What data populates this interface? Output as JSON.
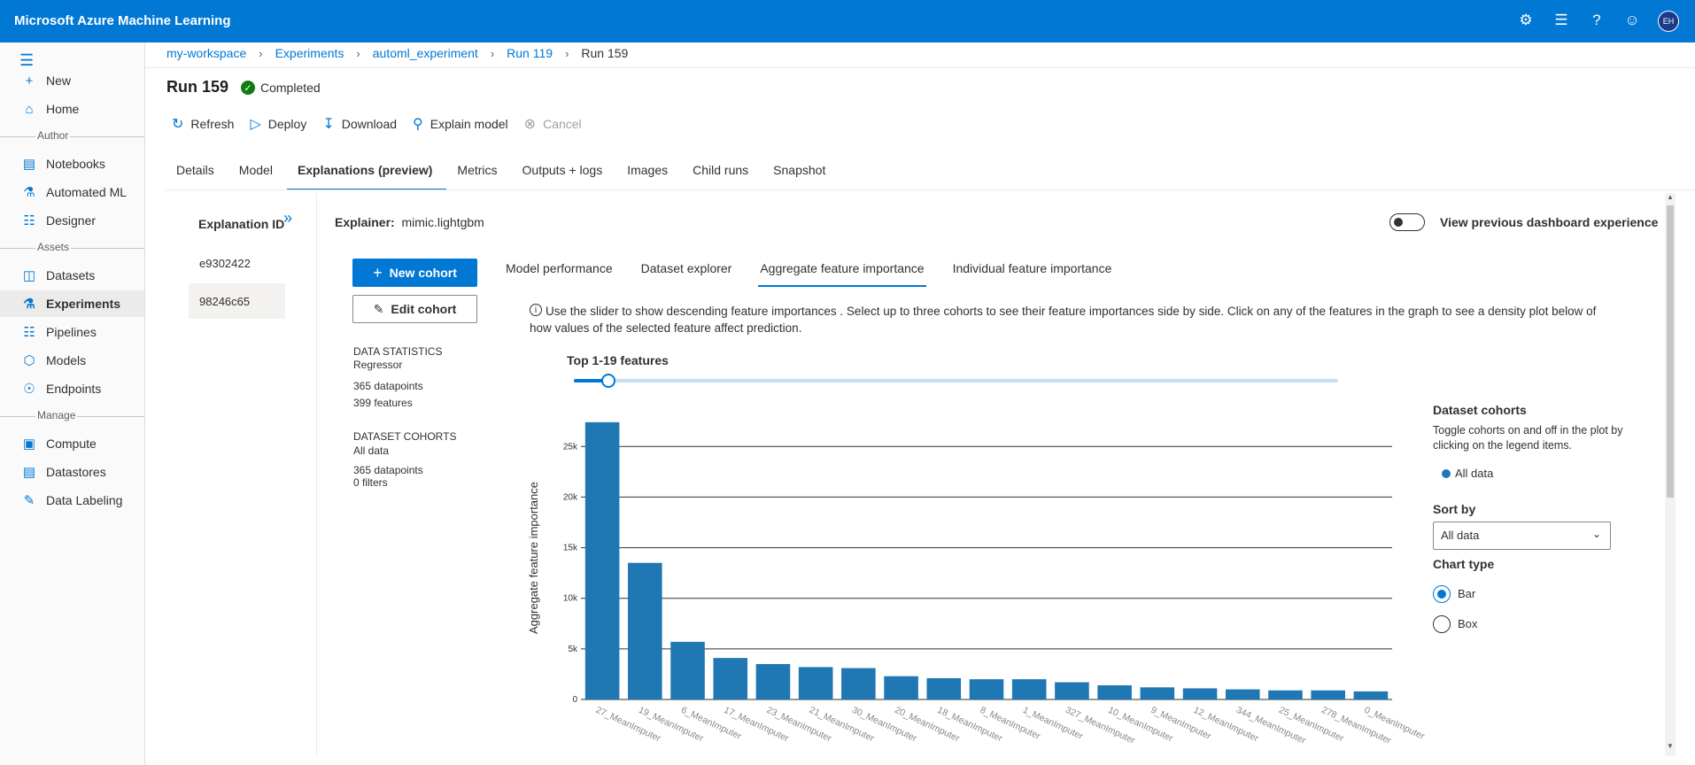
{
  "app": {
    "title": "Microsoft Azure Machine Learning",
    "user_initials": "EH"
  },
  "topbar_icons": [
    "settings-icon",
    "feedback-icon",
    "help-icon",
    "smiley-icon"
  ],
  "sidebar": {
    "items": [
      {
        "label": "New",
        "icon": "plus-icon"
      },
      {
        "label": "Home",
        "icon": "home-icon"
      },
      {
        "label": "Notebooks",
        "icon": "notebook-icon"
      },
      {
        "label": "Automated ML",
        "icon": "automl-icon"
      },
      {
        "label": "Designer",
        "icon": "designer-icon"
      },
      {
        "label": "Datasets",
        "icon": "datasets-icon"
      },
      {
        "label": "Experiments",
        "icon": "flask-icon"
      },
      {
        "label": "Pipelines",
        "icon": "pipelines-icon"
      },
      {
        "label": "Models",
        "icon": "models-icon"
      },
      {
        "label": "Endpoints",
        "icon": "endpoints-icon"
      },
      {
        "label": "Compute",
        "icon": "compute-icon"
      },
      {
        "label": "Datastores",
        "icon": "datastores-icon"
      },
      {
        "label": "Data Labeling",
        "icon": "labeling-icon"
      }
    ],
    "sections": [
      "Author",
      "Assets",
      "Manage"
    ]
  },
  "breadcrumb": [
    "my-workspace",
    "Experiments",
    "automl_experiment",
    "Run 119",
    "Run 159"
  ],
  "run": {
    "title": "Run 159",
    "status": "Completed"
  },
  "toolbar": [
    "Refresh",
    "Deploy",
    "Download",
    "Explain model",
    "Cancel"
  ],
  "tabs": [
    "Details",
    "Model",
    "Explanations (preview)",
    "Metrics",
    "Outputs + logs",
    "Images",
    "Child runs",
    "Snapshot"
  ],
  "explanations": {
    "header": "Explanation ID",
    "ids": [
      "e9302422",
      "98246c65"
    ]
  },
  "explainer": {
    "label": "Explainer:",
    "value": "mimic.lightgbm"
  },
  "toggle_label": "View previous dashboard experience",
  "buttons": {
    "new_cohort": "New cohort",
    "edit_cohort": "Edit cohort"
  },
  "stats": {
    "data_statistics": "DATA STATISTICS",
    "model_type": "Regressor",
    "datapoints": "365 datapoints",
    "features": "399 features",
    "dataset_cohorts": "DATASET COHORTS",
    "cohort_name": "All data",
    "cohort_datapoints": "365 datapoints",
    "cohort_filters": "0 filters"
  },
  "subtabs": [
    "Model performance",
    "Dataset explorer",
    "Aggregate feature importance",
    "Individual feature importance"
  ],
  "info_text": "Use the slider to show descending feature importances . Select up to three cohorts to see their feature importances side by side. Click on any of the features in the graph to see a density plot below of how values of the selected feature affect prediction.",
  "slider": {
    "label": "Top 1-19 features",
    "value_fraction": 0.05
  },
  "right_panel": {
    "cohorts_title": "Dataset cohorts",
    "cohorts_desc": "Toggle cohorts on and off in the plot by clicking on the legend items.",
    "legend_item": "All data",
    "sort_by_label": "Sort by",
    "sort_by_value": "All data",
    "chart_type_label": "Chart type",
    "chart_types": [
      "Bar",
      "Box"
    ],
    "selected_chart_type": "Bar"
  },
  "chart_data": {
    "type": "bar",
    "ylabel": "Aggregate feature importance",
    "xlabel": "",
    "ylim": [
      0,
      28000
    ],
    "yticks": [
      "0",
      "5k",
      "10k",
      "15k",
      "20k",
      "25k"
    ],
    "color": "#1f77b4",
    "grid": true,
    "categories": [
      "27_MeanImputer",
      "19_MeanImputer",
      "6_MeanImputer",
      "17_MeanImputer",
      "23_MeanImputer",
      "21_MeanImputer",
      "30_MeanImputer",
      "20_MeanImputer",
      "18_MeanImputer",
      "8_MeanImputer",
      "1_MeanImputer",
      "327_MeanImputer",
      "10_MeanImputer",
      "9_MeanImputer",
      "12_MeanImputer",
      "344_MeanImputer",
      "25_MeanImputer",
      "278_MeanImputer",
      "0_MeanImputer"
    ],
    "values": [
      27400,
      13500,
      5700,
      4100,
      3500,
      3200,
      3100,
      2300,
      2100,
      2000,
      2000,
      1700,
      1400,
      1200,
      1100,
      1000,
      900,
      900,
      800
    ]
  },
  "colors": {
    "accent": "#0078d4",
    "success": "#107c10",
    "bar": "#1f77b4"
  }
}
